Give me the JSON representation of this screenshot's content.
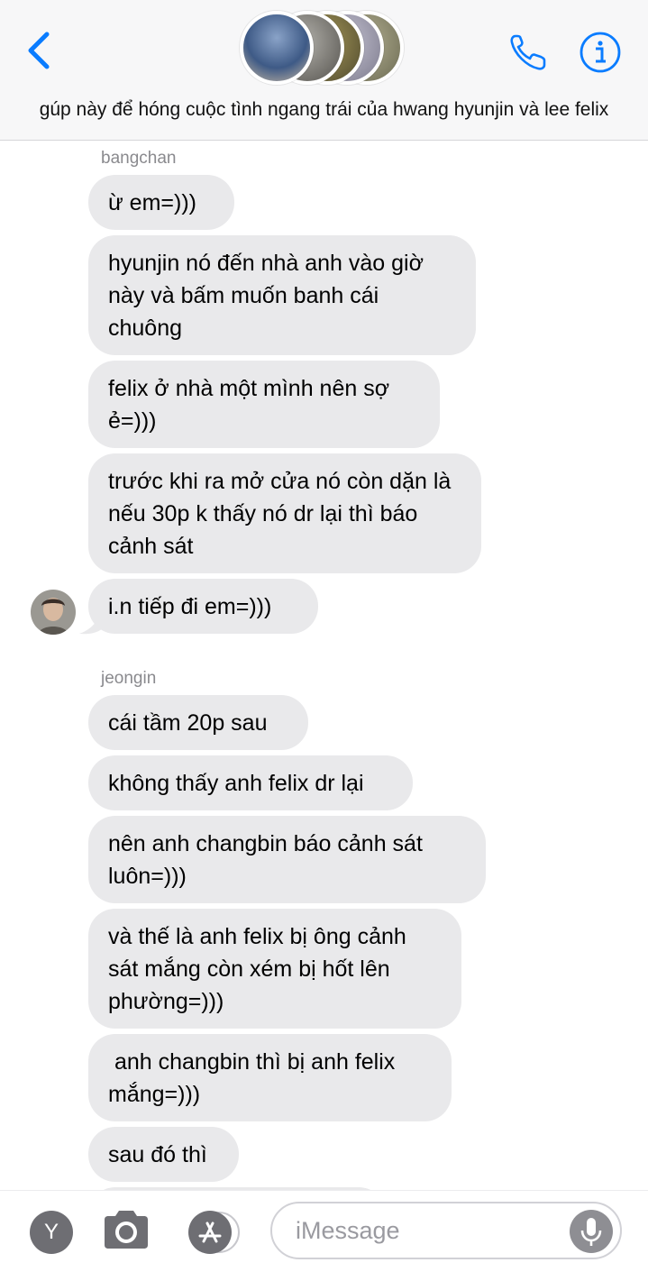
{
  "header": {
    "back_icon": "chevron-left-icon",
    "call_icon": "phone-icon",
    "info_icon": "info-icon",
    "group_title": "gúp này để hóng cuộc tình ngang trái của hwang hyunjin và lee felix",
    "accent_color": "#0a7cff"
  },
  "messages": {
    "group1": {
      "sender": "bangchan",
      "items": [
        "ừ em=)))",
        "hyunjin nó đến nhà anh vào giờ này và bấm muốn banh cái chuông",
        "felix ở nhà một mình nên sợ ẻ=)))",
        "trước khi ra mở cửa nó còn dặn là nếu 30p k thấy nó dr lại thì báo cảnh sát",
        "i.n tiếp đi em=)))"
      ]
    },
    "group2": {
      "sender": "jeongin",
      "items": [
        "cái tầm 20p sau",
        "không thấy anh felix dr lại",
        "nên anh changbin báo cảnh sát luôn=)))",
        "và thế là anh felix bị ông cảnh sát mắng còn xém bị hốt lên phường=)))",
        " anh changbin thì bị anh felix mắng=)))",
        "sau đó thì"
      ]
    }
  },
  "input_bar": {
    "app_icons": [
      "y-app-icon",
      "camera-icon",
      "app-store-icon"
    ],
    "y_label": "Y",
    "placeholder": "iMessage",
    "mic_icon": "microphone-icon"
  },
  "colors": {
    "bubble_received": "#e9e9eb",
    "header_bg": "#f7f7f8"
  }
}
